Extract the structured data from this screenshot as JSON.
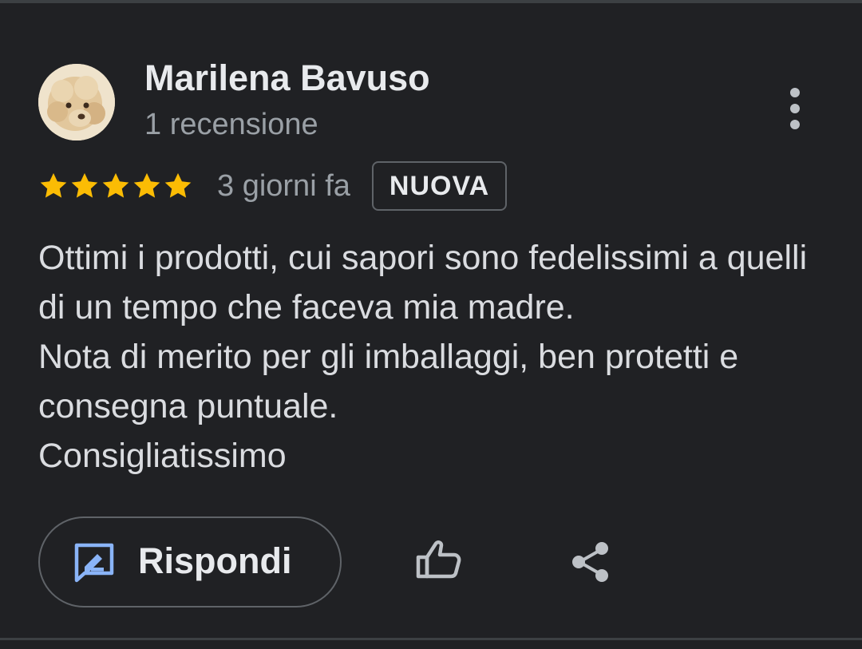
{
  "review": {
    "author_name": "Marilena Bavuso",
    "review_count": "1 recensione",
    "rating": 5,
    "rating_max": 5,
    "date": "3 giorni fa",
    "badge": "NUOVA",
    "text_lines": [
      "Ottimi i prodotti, cui sapori sono fedelissimi a quelli di un tempo che faceva mia madre.",
      "Nota di merito per gli imballaggi, ben protetti e consegna puntuale.",
      "Consigliatissimo"
    ]
  },
  "actions": {
    "reply_label": "Rispondi",
    "reply_icon": "reply-edit-icon",
    "like_icon": "thumb-up-icon",
    "share_icon": "share-icon",
    "more_icon": "more-vertical-icon"
  },
  "colors": {
    "background": "#202124",
    "star": "#fbbc04",
    "accent_blue": "#8ab4f8",
    "text_primary": "#e8eaed",
    "text_secondary": "#9aa0a6",
    "outline": "#5f6368"
  }
}
